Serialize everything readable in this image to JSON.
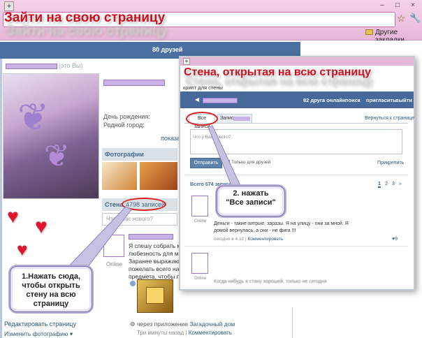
{
  "browser": {
    "new_tab_icon": "plus-icon",
    "window_controls": [
      "–",
      "□",
      "×"
    ],
    "bookmarks_folder_label": "Другие закладки",
    "star_icon": "star-icon",
    "settings_icon": "wrench-icon"
  },
  "overlay": {
    "main_title": "Зайти на свою страницу",
    "callout_1": [
      "1.Нажать сюда,",
      "чтобы открыть",
      "стену на всю",
      "страницу"
    ],
    "callout_2": [
      "2. нажать",
      "\"Все записи\""
    ]
  },
  "background_page": {
    "header_text": "80 друзей",
    "its_you": "(это Вы)",
    "birthday_label": "День рождения:",
    "city_label": "Родной город:",
    "show_link": "показа",
    "photos_header": "Фотографии",
    "wall_header": "Стена",
    "wall_count": "4798 записей",
    "new_post_placeholder": "Что у Вас нового?",
    "post_text": "Я спешу собрать ме\nлюбезность для ме\nЗаранее выражаю с\nпожелать всего нам\nпредмета, чтобы по",
    "post_online": "Online",
    "edit_page": "Редактировать страницу",
    "change_photo": "Изменить фотографию",
    "app_prefix": "через приложение",
    "app_name": "Загадочный дом",
    "time_ago": "Три минуты назад",
    "comment_link": "Комментировать"
  },
  "inset": {
    "title": "Стена, открытая на всю страницу",
    "breadcrumb": "крипт для стены",
    "nav": {
      "friends_online": "82 друга онлайн",
      "search": "поиск",
      "invite": "пригласить",
      "logout": "выйти"
    },
    "tabs": {
      "all_posts": "Все записи",
      "posts_prefix": "Записи"
    },
    "back_link": "Вернуться к странице",
    "input_placeholder": "Что у Вас нового?",
    "send_button": "Отправить",
    "friends_only": "Только для друзей",
    "attach": "Прикрепить",
    "total": "Всего 574 записи",
    "pages": [
      "1",
      "2",
      "3",
      "»"
    ],
    "post1": {
      "text": "Деньги - такие хитрые, заразы. Я на улицу - они за мной. Я\nдомой вернулась, а они - не фига !!!",
      "online": "Online",
      "meta_time": "сегодня в 4:12",
      "meta_link": "Комментировать",
      "likes": "9"
    },
    "post2": {
      "online": "Online",
      "text": "Когда-нибудь я стану хорошей, только не сегодня"
    }
  }
}
